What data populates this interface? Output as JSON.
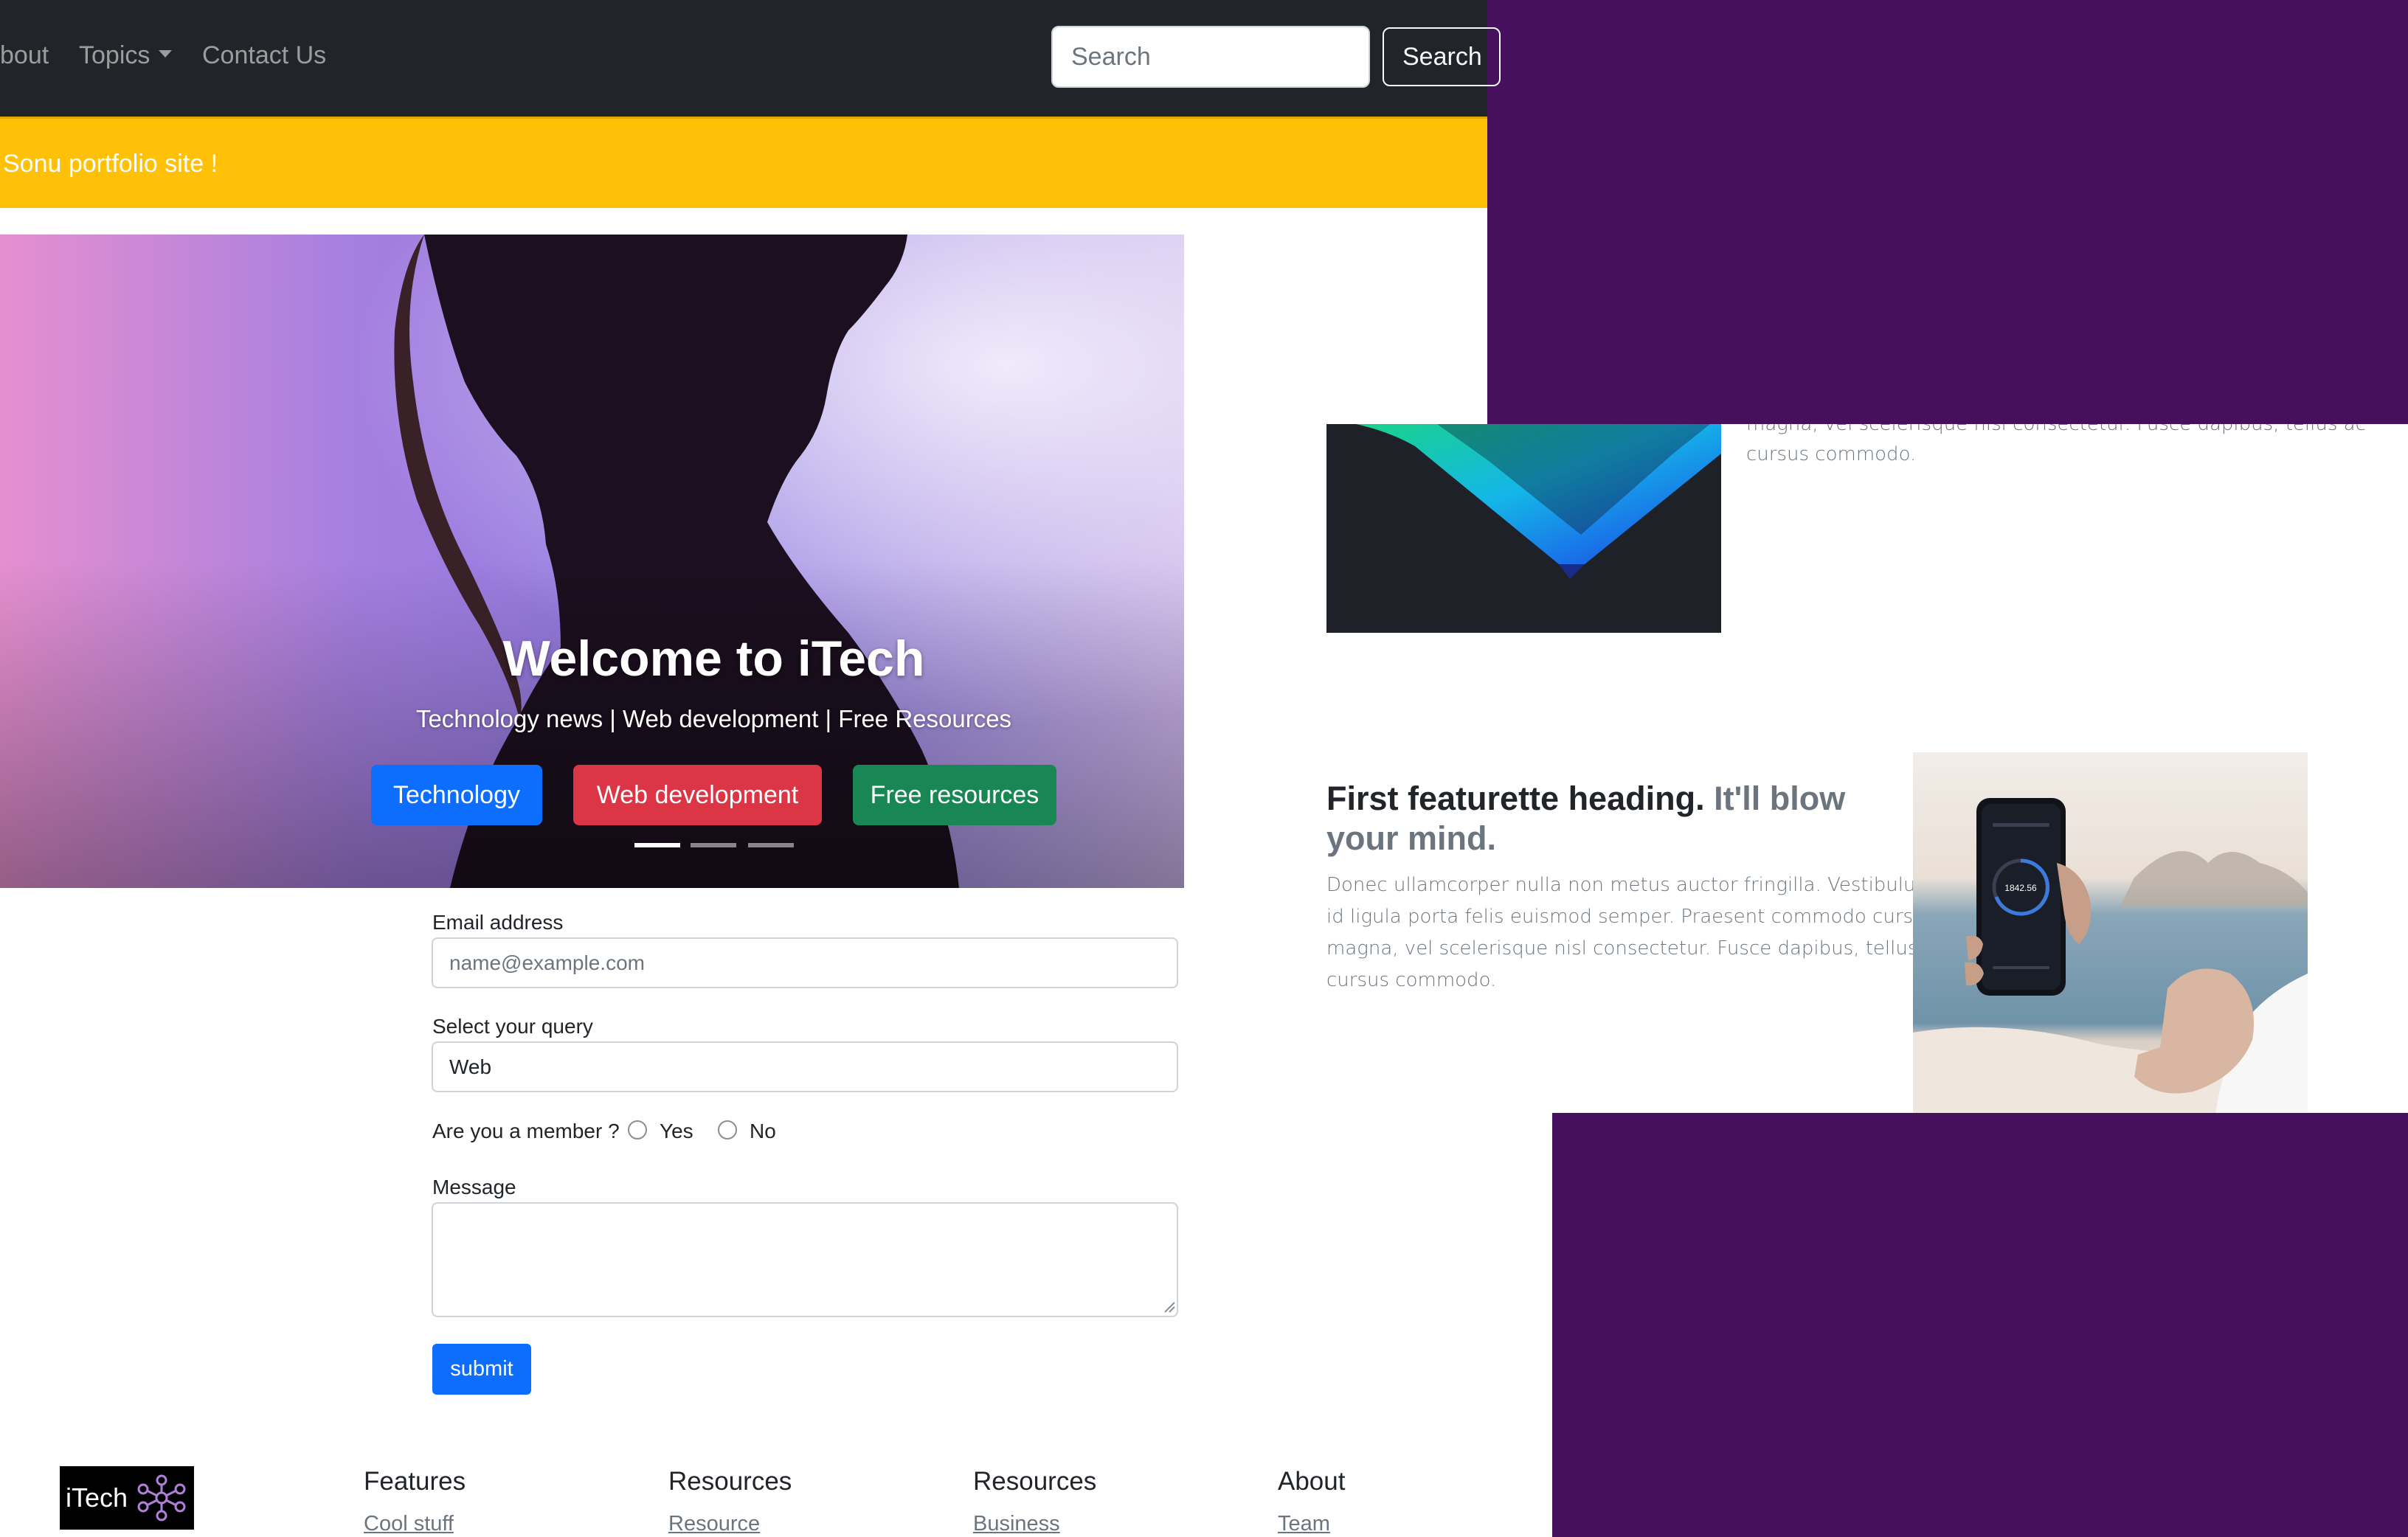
{
  "navbar": {
    "links": [
      "bout",
      "Topics",
      "Contact Us"
    ],
    "search_placeholder": "Search",
    "search_button": "Search"
  },
  "alert": {
    "text": "Sonu portfolio site !"
  },
  "hero": {
    "title": "Welcome to iTech",
    "subtitle": "Technology news | Web development | Free Resources",
    "buttons": [
      "Technology",
      "Web development",
      "Free resources"
    ],
    "button_colors": [
      "#0d6efd",
      "#dc3545",
      "#198754"
    ],
    "active_slide": 1,
    "slide_count": 3
  },
  "form": {
    "email_label": "Email address",
    "email_placeholder": "name@example.com",
    "query_label": "Select your query",
    "query_value": "Web",
    "member_label": "Are you a member ?",
    "member_options": [
      "Yes",
      "No"
    ],
    "message_label": "Message",
    "message_value": "",
    "submit_label": "submit"
  },
  "footer": {
    "logo_text": "iTech",
    "columns": [
      {
        "heading": "Features",
        "link": "Cool stuff"
      },
      {
        "heading": "Resources",
        "link": "Resource"
      },
      {
        "heading": "Resources",
        "link": "Business"
      },
      {
        "heading": "About",
        "link": "Team"
      }
    ]
  },
  "featurettes": {
    "top_text_fragment": "magna, vel scelerisque nisl consectetur. Fusce dapibus, tellus ac",
    "top_text_end": "cursus commodo.",
    "heading_main": "First featurette heading.",
    "heading_muted": "It'll blow your mind.",
    "body_lines": [
      "Donec ullamcorper nulla non metus auctor fringilla. Vestibulum",
      "id ligula porta felis euismod semper. Praesent commodo cursus",
      "magna, vel scelerisque nisl consectetur. Fusce dapibus, tellus ac",
      "cursus commodo."
    ],
    "phone_reading": "1842.56"
  },
  "colors": {
    "background_purple": "#46105f",
    "navbar": "#212529",
    "alert": "#ffc107",
    "primary": "#0d6efd"
  }
}
